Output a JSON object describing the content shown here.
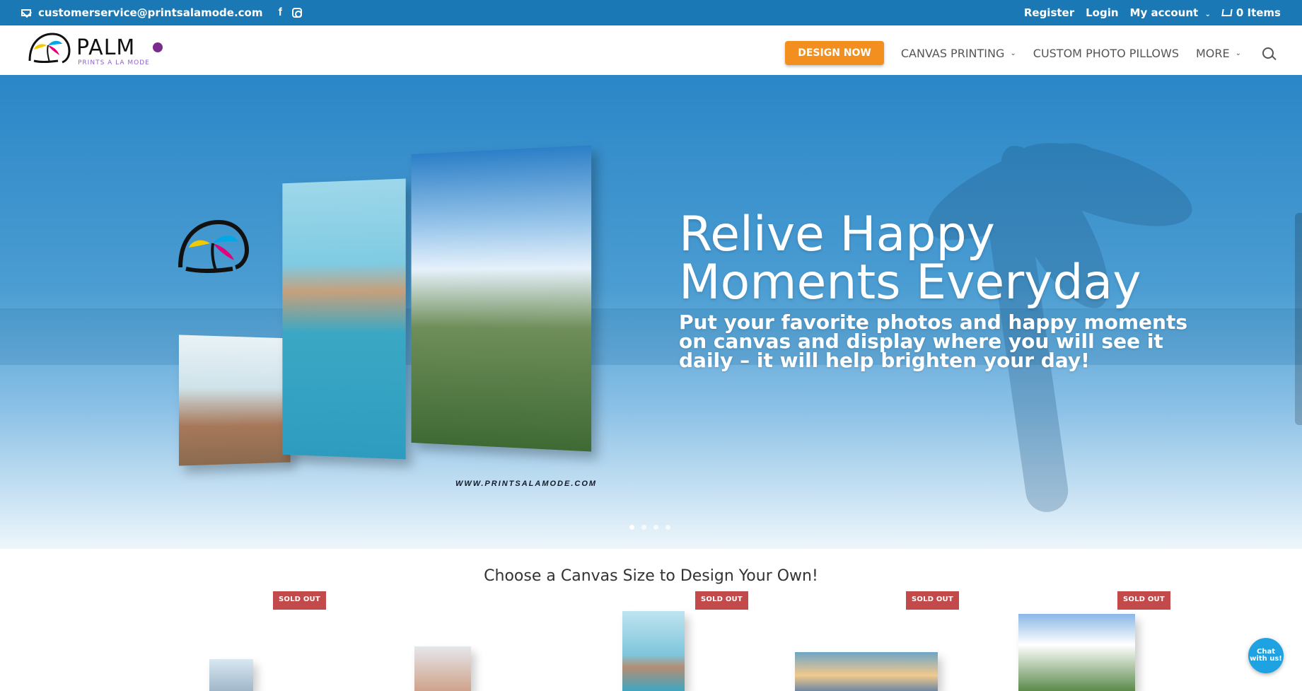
{
  "topbar": {
    "email": "customerservice@printsalamode.com",
    "social_fb": "f",
    "register": "Register",
    "login": "Login",
    "my_account": "My account",
    "cart": "0 Items",
    "colors": {
      "bar": "#1a78b4"
    }
  },
  "header": {
    "logo_brand": "PALM",
    "logo_tagline": "PRINTS A LA MODE",
    "nav": {
      "design_now": "DESIGN NOW",
      "canvas_printing": "CANVAS PRINTING",
      "custom_photo_pillows": "CUSTOM PHOTO PILLOWS",
      "more": "MORE"
    },
    "accent": "#f28f1f"
  },
  "hero": {
    "title": "Relive Happy Moments Everyday",
    "subtitle": "Put your favorite photos and happy moments on canvas and display where you will see it daily – it will help brighten your day!",
    "watermark": "WWW.PRINTSALAMODE.COM",
    "slides": 4
  },
  "section": {
    "title": "Choose a Canvas Size to Design Your Own!",
    "badge": "SOLD OUT"
  },
  "chat": {
    "label": "Chat with us!"
  },
  "icons": [
    "mail-icon",
    "facebook-icon",
    "instagram-icon",
    "chevron-down-icon",
    "cart-icon",
    "search-icon",
    "palm-logo-icon",
    "chat-icon"
  ]
}
